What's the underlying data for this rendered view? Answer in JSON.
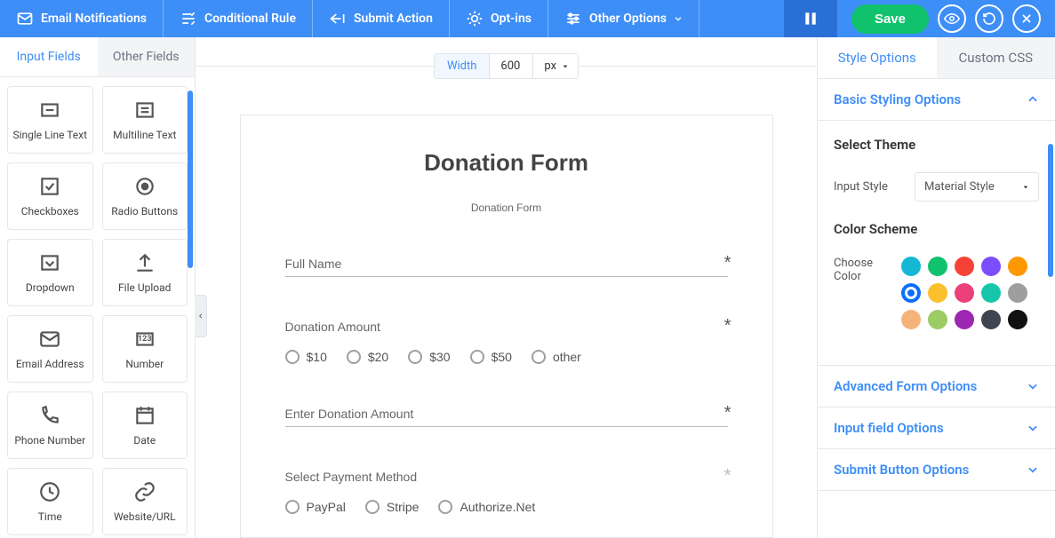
{
  "topbar": {
    "items": [
      {
        "label": "Email Notifications",
        "name": "email-notifications"
      },
      {
        "label": "Conditional Rule",
        "name": "conditional-rule"
      },
      {
        "label": "Submit Action",
        "name": "submit-action"
      },
      {
        "label": "Opt-ins",
        "name": "opt-ins"
      },
      {
        "label": "Other Options",
        "name": "other-options",
        "dropdown": true
      }
    ],
    "save": "Save"
  },
  "left_tabs": {
    "input": "Input Fields",
    "other": "Other Fields",
    "active": "input"
  },
  "input_fields": [
    {
      "label": "Single Line Text",
      "icon": "single-line"
    },
    {
      "label": "Multiline Text",
      "icon": "multi-line"
    },
    {
      "label": "Checkboxes",
      "icon": "checkbox"
    },
    {
      "label": "Radio Buttons",
      "icon": "radio"
    },
    {
      "label": "Dropdown",
      "icon": "dropdown"
    },
    {
      "label": "File Upload",
      "icon": "upload"
    },
    {
      "label": "Email Address",
      "icon": "email"
    },
    {
      "label": "Number",
      "icon": "number"
    },
    {
      "label": "Phone Number",
      "icon": "phone"
    },
    {
      "label": "Date",
      "icon": "date"
    },
    {
      "label": "Time",
      "icon": "time"
    },
    {
      "label": "Website/URL",
      "icon": "url"
    }
  ],
  "width_bar": {
    "label": "Width",
    "value": "600",
    "unit": "px"
  },
  "form": {
    "title": "Donation Form",
    "subtitle": "Donation Form",
    "fields": {
      "full_name": "Full Name",
      "donation_amount": "Donation Amount",
      "amount_options": [
        "$10",
        "$20",
        "$30",
        "$50",
        "other"
      ],
      "enter_amount": "Enter Donation Amount",
      "payment_method": "Select Payment Method",
      "payment_options": [
        "PayPal",
        "Stripe",
        "Authorize.Net"
      ]
    }
  },
  "right_tabs": {
    "style": "Style Options",
    "css": "Custom CSS",
    "active": "style"
  },
  "style": {
    "basic_heading": "Basic Styling Options",
    "select_theme": "Select Theme",
    "input_style_label": "Input Style",
    "input_style_value": "Material Style",
    "color_scheme": "Color Scheme",
    "choose_color": "Choose Color",
    "colors": [
      "#14b8d4",
      "#11c26d",
      "#f44336",
      "#7c4dff",
      "#ff9800",
      "#0d6efd",
      "#fbc02d",
      "#ec407a",
      "#17c6aa",
      "#9e9e9e",
      "#f5b27a",
      "#9ccc65",
      "#9c27b0",
      "#3f4551",
      "#111111"
    ],
    "selected_color_index": 5,
    "advanced": "Advanced Form Options",
    "input_opts": "Input field Options",
    "submit_opts": "Submit Button Options"
  }
}
